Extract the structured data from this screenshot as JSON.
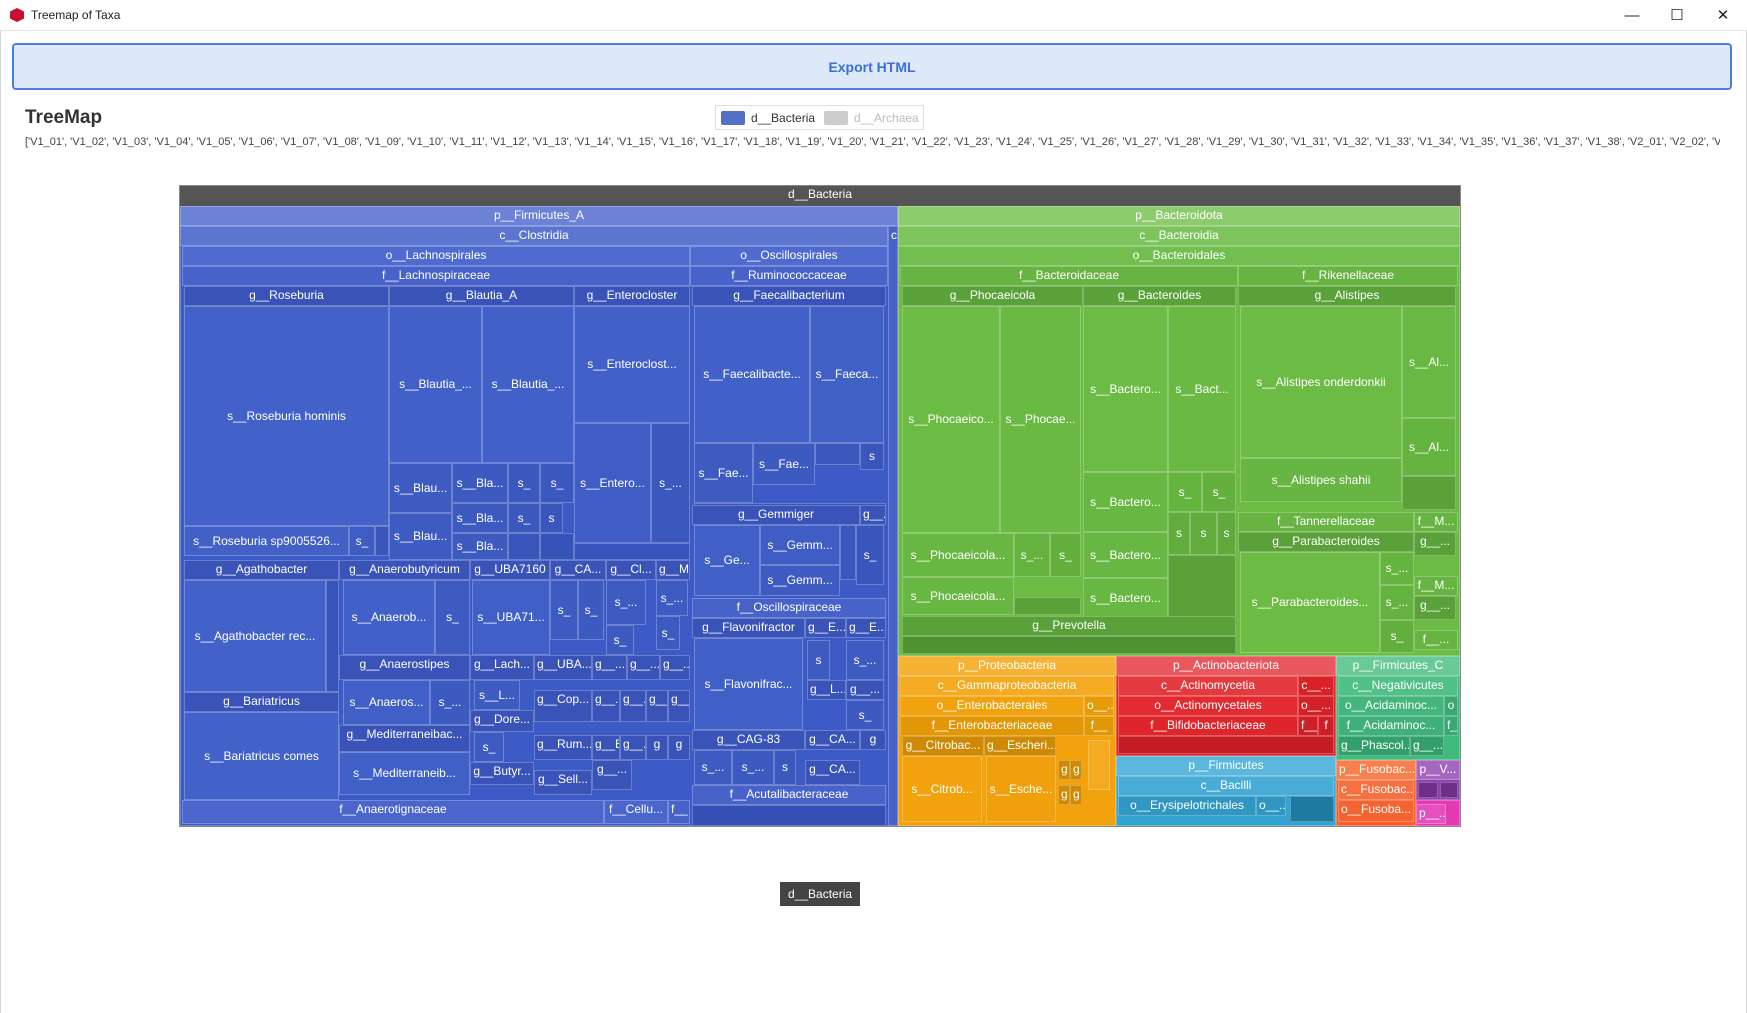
{
  "window": {
    "title": "Treemap of Taxa",
    "minimize": "—",
    "maximize": "☐",
    "close": "✕"
  },
  "toolbar": {
    "export_label": "Export HTML"
  },
  "header": {
    "title": "TreeMap"
  },
  "legend": [
    {
      "label": "d__Bacteria",
      "color": "#5470c6",
      "active": true
    },
    {
      "label": "d__Archaea",
      "color": "#cccccc",
      "active": false
    }
  ],
  "samples_text": "['V1_01', 'V1_02', 'V1_03', 'V1_04', 'V1_05', 'V1_06', 'V1_07', 'V1_08', 'V1_09', 'V1_10', 'V1_11', 'V1_12', 'V1_13', 'V1_14', 'V1_15', 'V1_16', 'V1_17', 'V1_18', 'V1_19', 'V1_20', 'V1_21', 'V1_22', 'V1_23', 'V1_24', 'V1_25', 'V1_26', 'V1_27', 'V1_28', 'V1_29', 'V1_30', 'V1_31', 'V1_32', 'V1_33', 'V1_34', 'V1_35', 'V1_36', 'V1_37', 'V1_38', 'V2_01', 'V2_02', 'V2_",
  "breadcrumb": "d__Bacteria",
  "colors": {
    "firmicutes_a": "#3d5bc6",
    "bacteroidota": "#6cbb45",
    "proteobacteria": "#f2a20d",
    "actinobacteriota": "#e0252c",
    "firmicutes": "#35a3cf",
    "firmicutes_c": "#3fb97c",
    "fusobacteriota": "#f7602b",
    "verrucomicrobiota": "#8e44ad"
  },
  "treemap_labels": {
    "root": "d__Bacteria",
    "p_firmicutes_a": "p__Firmicutes_A",
    "c_clostridia": "c__Clostridia",
    "c_small": "c",
    "o_lachnospirales": "o__Lachnospirales",
    "f_lachnospiraceae": "f__Lachnospiraceae",
    "g_roseburia": "g__Roseburia",
    "s_roseburia_hominis": "s__Roseburia hominis",
    "s_roseburia_sp": "s__Roseburia sp9005526...",
    "s_ros_small": "s_",
    "g_blautia_a": "g__Blautia_A",
    "s_blautia_1": "s__Blautia_...",
    "s_blautia_2": "s__Blautia_...",
    "s_blau_3": "s__Blau...",
    "s_bla_4": "s__Bla...",
    "s_bla_5": "s__Bla...",
    "s_bla_6": "s__Bla...",
    "s_blau_7": "s__Blau...",
    "s_small": "s_",
    "s_tiny": "s",
    "g_enterocloster": "g__Enterocloster",
    "s_enterocloster": "s__Enteroclost...",
    "s_entero_2": "s__Entero...",
    "s_dots": "s_...",
    "g_agathobacter": "g__Agathobacter",
    "s_agathobacter": "s__Agathobacter rec...",
    "g_anaerobutyricum": "g__Anaerobutyricum",
    "s_anaerob": "s__Anaerob...",
    "g_uba7160": "g__UBA7160",
    "s_uba71": "s__UBA71...",
    "g_ca": "g__CA...",
    "g_cl": "g__Cl...",
    "g_m": "g__M...",
    "g_anaerostipes": "g__Anaerostipes",
    "s_anaeros": "s__Anaeros...",
    "g_lach": "g__Lach...",
    "g_uba": "g__UBA...",
    "g_dots": "g__...",
    "s_l": "s__L...",
    "g_cop": "g__Cop...",
    "g_bariatricus": "g__Bariatricus",
    "s_bariatricus": "s__Bariatricus comes",
    "g_mediterraneibac": "g__Mediterraneibac...",
    "s_mediterraneib": "s__Mediterraneib...",
    "g_dore": "g__Dore...",
    "g_rum": "g__Rum...",
    "g_e": "g__E...",
    "g_g": "g",
    "g_butyr": "g__Butyr...",
    "g_sell": "g__Sell...",
    "f_anaerotignaceae": "f__Anaerotignaceae",
    "f_cellu": "f__Cellu...",
    "f_small": "f__",
    "o_oscillospirales": "o__Oscillospirales",
    "f_ruminococcaceae": "f__Ruminococcaceae",
    "g_faecalibacterium": "g__Faecalibacterium",
    "s_faecalibacte": "s__Faecalibacte...",
    "s_faeca": "s__Faeca...",
    "s_fae_1": "s__Fae...",
    "s_fae_2": "s__Fae...",
    "g_gemmiger": "g__Gemmiger",
    "g_gemm_dots": "g__...",
    "s_ge": "s__Ge...",
    "s_gemm_1": "s__Gemm...",
    "s_gemm_2": "s__Gemm...",
    "f_oscillospiraceae": "f__Oscillospiraceae",
    "g_flavonifractor": "g__Flavonifractor",
    "s_flavonifrac": "s__Flavonifrac...",
    "g_e_1": "g__E...",
    "g_e_2": "g__E...",
    "g_l": "g__L...",
    "g_cag83": "g__CAG-83",
    "g_ca_2": "g__CA...",
    "f_acutalibacteraceae": "f__Acutalibacteraceae",
    "p_bacteroidota": "p__Bacteroidota",
    "c_bacteroidia": "c__Bacteroidia",
    "o_bacteroidales": "o__Bacteroidales",
    "f_bacteroidaceae": "f__Bacteroidaceae",
    "g_phocaeicola": "g__Phocaeicola",
    "s_phocaeico": "s__Phocaeico...",
    "s_phocae": "s__Phocae...",
    "s_phocaeicola_1": "s__Phocaeicola...",
    "s_phocaeicola_2": "s__Phocaeicola...",
    "g_bacteroides": "g__Bacteroides",
    "s_bactero_1": "s__Bactero...",
    "s_bact": "s__Bact...",
    "s_bactero_2": "s__Bactero...",
    "s_bactero_3": "s__Bactero...",
    "s_bactero_4": "s__Bactero...",
    "g_prevotella": "g__Prevotella",
    "f_rikenellaceae": "f__Rikenellaceae",
    "g_alistipes": "g__Alistipes",
    "s_alistipes_onderdonkii": "s__Alistipes onderdonkii",
    "s_alistipes_shahii": "s__Alistipes shahii",
    "s_al_1": "s__Al...",
    "s_al_2": "s__Al...",
    "f_tannerellaceae": "f__Tannerellaceae",
    "f_m_1": "f__M...",
    "g_parabacteroides": "g__Parabacteroides",
    "s_parabacteroides": "s__Parabacteroides...",
    "f_m_2": "f__M...",
    "f_dots": "f__...",
    "p_proteobacteria": "p__Proteobacteria",
    "c_gammaproteobacteria": "c__Gammaproteobacteria",
    "o_enterobacterales": "o__Enterobacterales",
    "o_dots": "o__...",
    "f_enterobacteriaceae": "f__Enterobacteriaceae",
    "g_citrobac": "g__Citrobac...",
    "g_escheri": "g__Escheri...",
    "s_citrob": "s__Citrob...",
    "s_esche": "s__Esche...",
    "p_actinobacteriota": "p__Actinobacteriota",
    "c_actinomycetia": "c__Actinomycetia",
    "c_dots": "c__...",
    "o_actinomycetales": "o__Actinomycetales",
    "f_bifidobacteriaceae": "f__Bifidobacteriaceae",
    "f_f": "f",
    "p_firmicutes": "p__Firmicutes",
    "c_bacilli": "c__Bacilli",
    "o_erysipelotrichales": "o__Erysipelotrichales",
    "p_firmicutes_c": "p__Firmicutes_C",
    "c_negativicutes": "c__Negativicutes",
    "o_acidaminoc": "o__Acidaminoc...",
    "o_small": "o",
    "f_acidaminoc": "f__Acidaminoc...",
    "g_phascol": "g__Phascol...",
    "p_fusobac": "p__Fusobac...",
    "c_fusobac": "c__Fusobac...",
    "o_fusoba": "o__Fusoba...",
    "p_v": "p__V...",
    "p_dots": "p__..."
  }
}
